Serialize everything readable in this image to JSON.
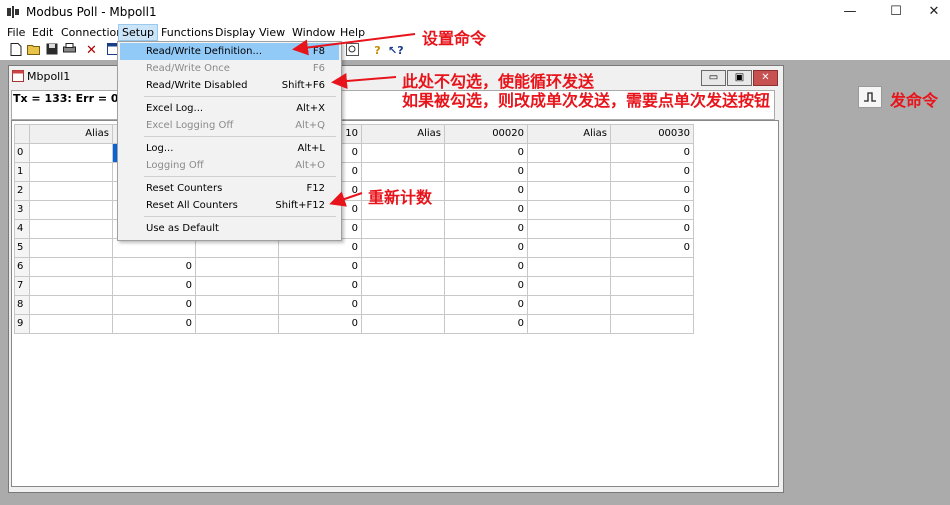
{
  "window": {
    "title": "Modbus Poll - Mbpoll1",
    "controls": [
      "—",
      "☐",
      "✕"
    ]
  },
  "menubar": [
    "File",
    "Edit",
    "Connection",
    "Setup",
    "Functions",
    "Display",
    "View",
    "Window",
    "Help"
  ],
  "toolbar_icons": [
    "new-icon",
    "open-icon",
    "save-icon",
    "print-icon",
    "delete-icon",
    "window-icon",
    "help-icon",
    "context-help-icon"
  ],
  "setup_menu": {
    "items": [
      {
        "label": "Read/Write Definition...",
        "shortcut": "F8",
        "state": "highlighted"
      },
      {
        "label": "Read/Write Once",
        "shortcut": "F6",
        "state": "disabled"
      },
      {
        "label": "Read/Write Disabled",
        "shortcut": "Shift+F6",
        "state": "normal"
      },
      {
        "label": "Excel Log...",
        "shortcut": "Alt+X",
        "state": "normal"
      },
      {
        "label": "Excel Logging Off",
        "shortcut": "Alt+Q",
        "state": "disabled"
      },
      {
        "label": "Log...",
        "shortcut": "Alt+L",
        "state": "normal"
      },
      {
        "label": "Logging Off",
        "shortcut": "Alt+O",
        "state": "disabled"
      },
      {
        "label": "Reset Counters",
        "shortcut": "F12",
        "state": "normal"
      },
      {
        "label": "Reset All Counters",
        "shortcut": "Shift+F12",
        "state": "normal"
      },
      {
        "label": "Use as Default",
        "shortcut": "",
        "state": "normal"
      }
    ]
  },
  "child_window": {
    "title": "Mbpoll1",
    "status": "Tx = 133: Err = 0: ID =",
    "headers": [
      "Alias",
      "",
      "",
      "10",
      "Alias",
      "00020",
      "Alias",
      "00030"
    ],
    "row_labels": [
      "0",
      "1",
      "2",
      "3",
      "4",
      "5",
      "6",
      "7",
      "8",
      "9"
    ],
    "col_b_values": [
      "",
      "",
      "",
      "",
      "",
      "",
      "0",
      "0",
      "0",
      "0"
    ],
    "col_d_values": [
      "0",
      "0",
      "0",
      "0",
      "0",
      "0",
      "0",
      "0",
      "0",
      "0"
    ],
    "col_f_values": [
      "0",
      "0",
      "0",
      "0",
      "0",
      "0",
      "0",
      "0",
      "0",
      "0"
    ],
    "col_h_values": [
      "0",
      "0",
      "0",
      "0",
      "0",
      "0",
      "",
      "",
      "",
      ""
    ]
  },
  "annotations": {
    "set_command": "设置命令",
    "no_check_line": "此处不勾选，使能循环发送",
    "if_checked_line": "如果被勾选，则改成单次发送，需要点单次发送按钮",
    "send_command": "发命令",
    "recount": "重新计数"
  },
  "colors": {
    "annotation": "#e8141b",
    "menu_highlight": "#91c9f7",
    "mdi_background": "#ababab"
  }
}
